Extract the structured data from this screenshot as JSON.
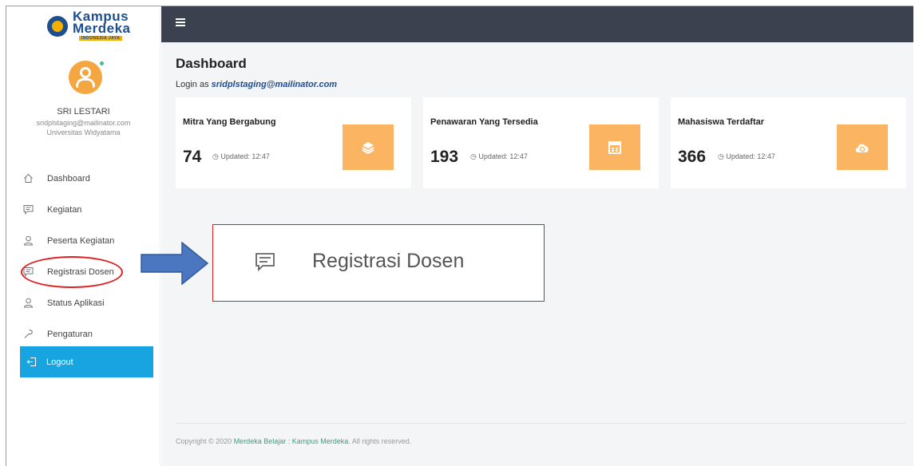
{
  "logo": {
    "line1": "Kampus",
    "line2": "Merdeka",
    "tagline": "INDONESIA JAYA"
  },
  "user": {
    "name": "SRI LESTARI",
    "email": "sridplstaging@mailinator.com",
    "university": "Universitas Widyatama"
  },
  "sidebar": {
    "items": [
      {
        "label": "Dashboard",
        "icon": "home-icon"
      },
      {
        "label": "Kegiatan",
        "icon": "message-icon"
      },
      {
        "label": "Peserta Kegiatan",
        "icon": "user-icon"
      },
      {
        "label": "Registrasi Dosen",
        "icon": "message-icon"
      },
      {
        "label": "Status Aplikasi",
        "icon": "user-icon"
      },
      {
        "label": "Pengaturan",
        "icon": "wrench-icon"
      }
    ],
    "logout_label": "Logout"
  },
  "header": {
    "title": "Dashboard",
    "login_prefix": "Login as",
    "login_email": "sridplstaging@mailinator.com"
  },
  "cards": [
    {
      "title": "Mitra Yang Bergabung",
      "value": "74",
      "updated": "Updated: 12:47",
      "icon": "layers-icon"
    },
    {
      "title": "Penawaran Yang Tersedia",
      "value": "193",
      "updated": "Updated: 12:47",
      "icon": "calendar-icon"
    },
    {
      "title": "Mahasiswa Terdaftar",
      "value": "366",
      "updated": "Updated: 12:47",
      "icon": "cloud-sync-icon"
    }
  ],
  "callout": {
    "label": "Registrasi Dosen"
  },
  "footer": {
    "prefix": "Copyright © 2020",
    "link": "Merdeka Belajar : Kampus Merdeka",
    "suffix": ". All rights reserved."
  },
  "colors": {
    "topbar": "#3b414f",
    "accent": "#18a4e0",
    "card_icon_bg": "#fbb462",
    "highlight": "#e02020"
  }
}
